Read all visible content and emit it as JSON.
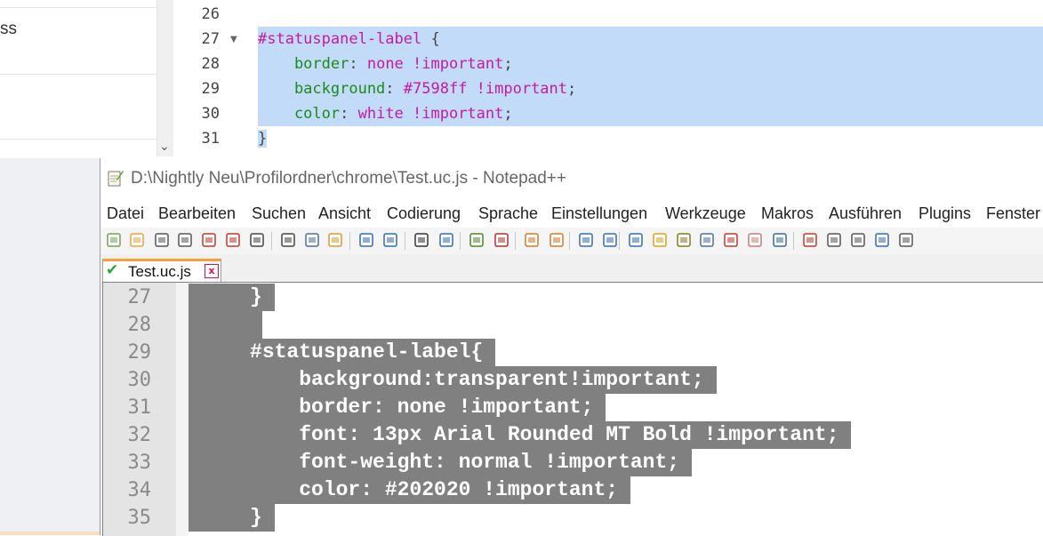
{
  "top_editor": {
    "left_panel_text": "ss",
    "line_numbers": [
      "26",
      "27",
      "28",
      "29",
      "30",
      "31"
    ],
    "lines": [
      {
        "parts": []
      },
      {
        "parts": [
          {
            "t": "#statuspanel-label",
            "c": "c-sel"
          },
          {
            "t": " {",
            "c": "c-pun"
          }
        ]
      },
      {
        "parts": [
          {
            "t": "    border",
            "c": "c-prop"
          },
          {
            "t": ": ",
            "c": "c-pun"
          },
          {
            "t": "none !important",
            "c": "c-val"
          },
          {
            "t": ";",
            "c": "c-pun"
          }
        ]
      },
      {
        "parts": [
          {
            "t": "    background",
            "c": "c-prop"
          },
          {
            "t": ": ",
            "c": "c-pun"
          },
          {
            "t": "#7598ff !important",
            "c": "c-val"
          },
          {
            "t": ";",
            "c": "c-pun"
          }
        ]
      },
      {
        "parts": [
          {
            "t": "    color",
            "c": "c-prop"
          },
          {
            "t": ": ",
            "c": "c-pun"
          },
          {
            "t": "white !important",
            "c": "c-val"
          },
          {
            "t": ";",
            "c": "c-pun"
          }
        ]
      },
      {
        "parts": [
          {
            "t": "}",
            "c": "c-pun"
          }
        ]
      }
    ]
  },
  "npp": {
    "title": "D:\\Nightly Neu\\Profilordner\\chrome\\Test.uc.js - Notepad++",
    "menu": [
      "Datei",
      "Bearbeiten",
      "Suchen",
      "Ansicht",
      "Codierung",
      "Sprache",
      "Einstellungen",
      "Werkzeuge",
      "Makros",
      "Ausführen",
      "Plugins",
      "Fenster"
    ],
    "tab_label": "Test.uc.js",
    "tab_close": "x",
    "toolbar_icons": [
      "new-file-icon",
      "open-file-icon",
      "save-icon",
      "save-all-icon",
      "close-icon",
      "close-all-icon",
      "print-icon",
      "cut-icon",
      "copy-icon",
      "paste-icon",
      "undo-icon",
      "redo-icon",
      "find-icon",
      "replace-icon",
      "zoom-in-icon",
      "zoom-out-icon",
      "sync-vertical-icon",
      "sync-horizontal-icon",
      "word-wrap-icon",
      "show-all-chars-icon",
      "indent-guide-icon",
      "user-language-icon",
      "doc-map-icon",
      "function-list-icon",
      "folder-workspace-icon",
      "monitoring-icon",
      "monitor-icon",
      "record-macro-icon",
      "stop-macro-icon",
      "play-macro-icon",
      "run-macro-multiple-icon",
      "save-macro-icon"
    ],
    "line_numbers": [
      "27",
      "28",
      "29",
      "30",
      "31",
      "32",
      "33",
      "34",
      "35"
    ],
    "lines": [
      "     }",
      "",
      "     #statuspanel-label{",
      "         background:transparent!important;",
      "         border: none !important;",
      "         font: 13px Arial Rounded MT Bold !important;",
      "         font-weight: normal !important;",
      "         color: #202020 !important;",
      "     }"
    ]
  }
}
